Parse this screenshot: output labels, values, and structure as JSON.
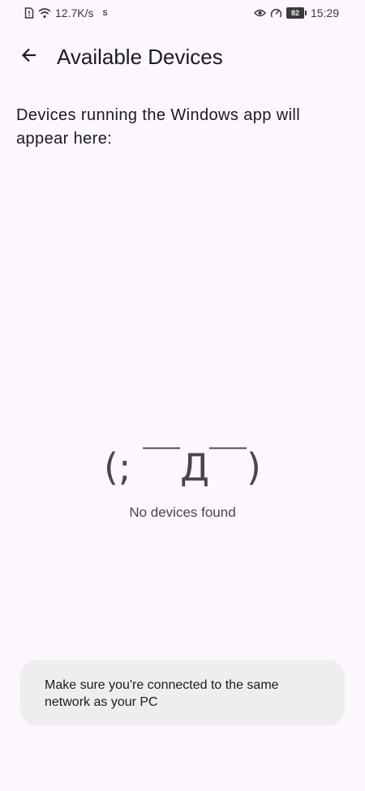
{
  "status_bar": {
    "network_speed": "12.7K/s",
    "extra_indicator": "S",
    "battery_level": "82",
    "time": "15:29",
    "icons": [
      "notification-alert-icon",
      "wifi-icon",
      "eye-icon",
      "speedometer-icon",
      "battery-icon"
    ]
  },
  "header": {
    "back_icon": "arrow-left-icon",
    "title": "Available Devices"
  },
  "main": {
    "description": "Devices running the Windows app will appear here:",
    "empty_state": {
      "kaomoji": "(; ￣Д￣)",
      "message": "No devices found"
    }
  },
  "hint": {
    "text": "Make sure you're connected to the same network as your PC"
  },
  "colors": {
    "background": "#fcf6fd",
    "text_primary": "#1c1b1f",
    "text_secondary": "#49454f",
    "card_background": "#efedef"
  }
}
